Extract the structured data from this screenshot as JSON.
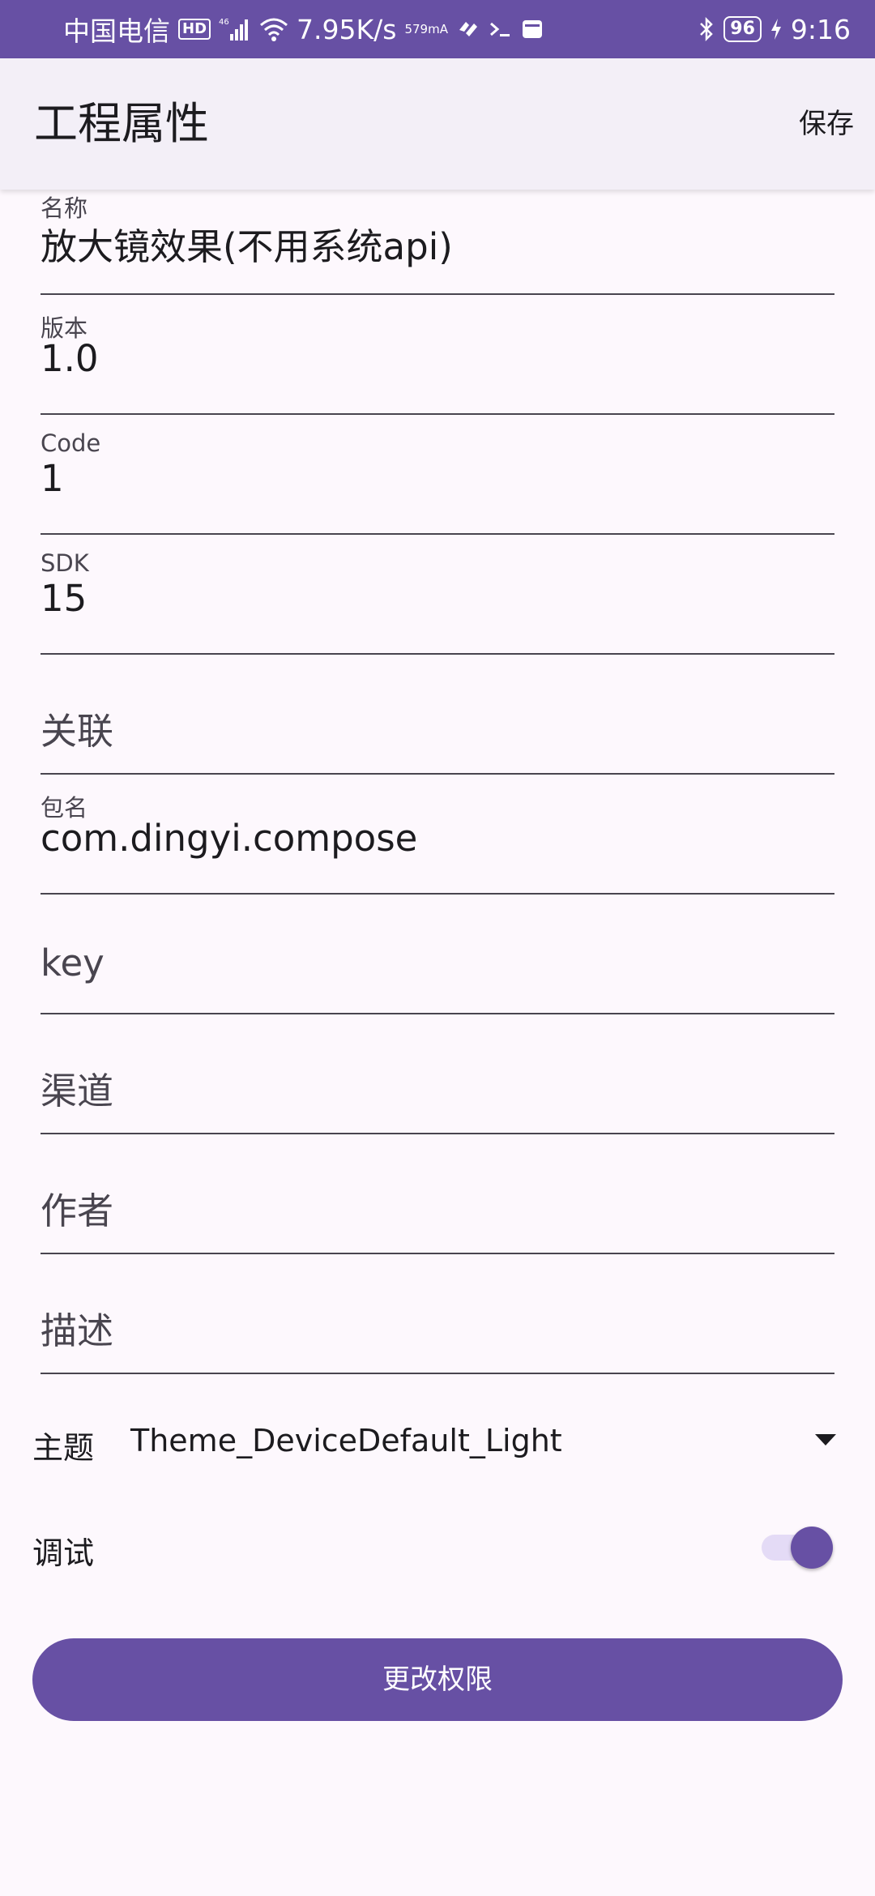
{
  "status_bar": {
    "carrier": "中国电信",
    "hd": "HD",
    "network": "46",
    "speed": "7.95K/s",
    "current_top": "579",
    "current_bottom": "mA",
    "battery": "96",
    "time": "9:16"
  },
  "app_bar": {
    "title": "工程属性",
    "save_label": "保存"
  },
  "fields": {
    "name": {
      "label": "名称",
      "value": "放大镜效果(不用系统api)"
    },
    "version": {
      "label": "版本",
      "value": "1.0"
    },
    "code": {
      "label": "Code",
      "value": "1"
    },
    "sdk": {
      "label": "SDK",
      "value": "15"
    },
    "association": {
      "placeholder": "关联"
    },
    "package": {
      "label": "包名",
      "value": "com.dingyi.compose"
    },
    "key": {
      "placeholder": "key"
    },
    "channel": {
      "placeholder": "渠道"
    },
    "author": {
      "placeholder": "作者"
    },
    "description": {
      "placeholder": "描述"
    }
  },
  "theme": {
    "label": "主题",
    "selected": "Theme_DeviceDefault_Light"
  },
  "debug": {
    "label": "调试",
    "enabled": true
  },
  "permissions_button": "更改权限",
  "colors": {
    "primary": "#6750a4",
    "background": "#fdf8fd",
    "app_bar": "#f3eff7"
  }
}
